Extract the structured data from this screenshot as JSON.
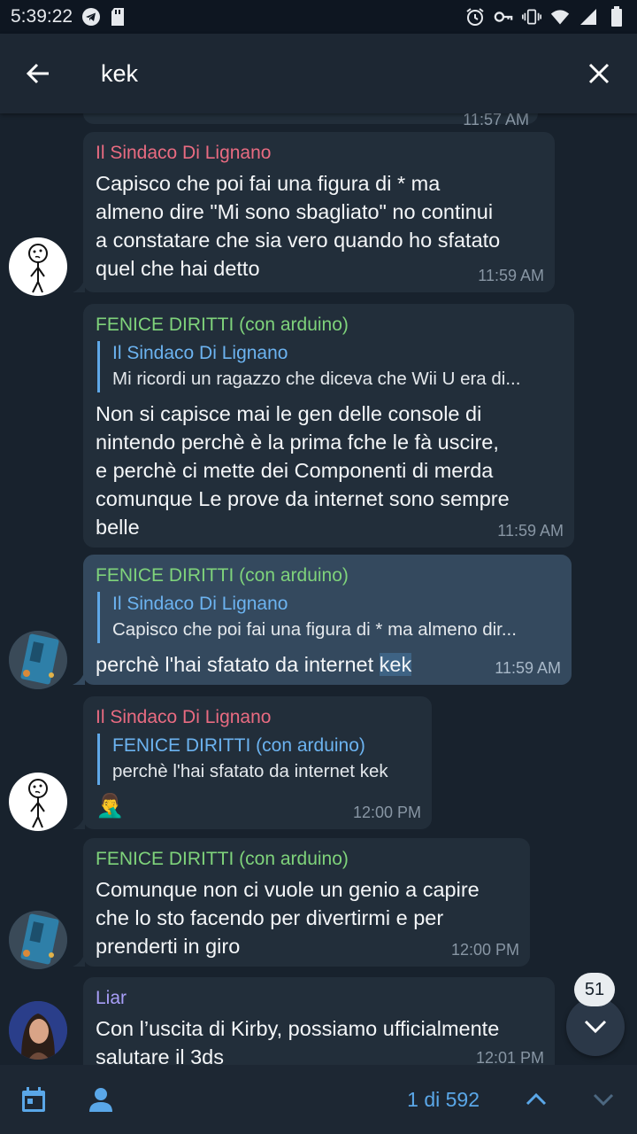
{
  "status": {
    "time": "5:39:22",
    "left_icons": [
      "telegram-icon",
      "sd-card-icon"
    ],
    "right_icons": [
      "alarm-icon",
      "vpn-key-icon",
      "vibrate-icon",
      "wifi-icon",
      "signal-icon",
      "battery-icon"
    ]
  },
  "search": {
    "query": "kek"
  },
  "partial_top_time": "11:57 AM",
  "messages": [
    {
      "sender": "Il Sindaco Di Lignano",
      "text": "Capisco che poi fai una figura di * ma\nalmeno dire \"Mi sono sbagliato\" no continui\na constatare che sia vero quando ho sfatato\nquel che hai detto",
      "time": "11:59 AM"
    },
    {
      "sender": "FENICE DIRITTI (con arduino)",
      "reply_name": "Il Sindaco Di Lignano",
      "reply_text": "Mi ricordi un ragazzo che diceva che Wii U era di...",
      "text": "Non si capisce mai le gen delle console di\nnintendo perchè è la prima fche le fà uscire,\ne perchè ci mette dei Componenti di merda\ncomunque Le prove da internet sono sempre\nbelle",
      "time": "11:59 AM"
    },
    {
      "sender": "FENICE DIRITTI (con arduino)",
      "reply_name": "Il Sindaco Di Lignano",
      "reply_text": "Capisco che poi fai una figura di * ma almeno dir...",
      "text_before": "perchè l'hai sfatato da internet ",
      "highlight": "kek",
      "time": "11:59 AM"
    },
    {
      "sender": "Il Sindaco Di Lignano",
      "reply_name": "FENICE DIRITTI (con arduino)",
      "reply_text": "perchè l'hai sfatato da internet kek",
      "emoji": "🤦‍♂️",
      "time": "12:00 PM"
    },
    {
      "sender": "FENICE DIRITTI (con arduino)",
      "text": "Comunque non ci vuole un genio a capire\nche lo sto facendo per divertirmi e per\nprenderti in giro",
      "time": "12:00 PM"
    },
    {
      "sender": "Liar",
      "text": "Con l’uscita di Kirby, possiamo ufficialmente\nsalutare il 3ds",
      "time": "12:01 PM"
    }
  ],
  "unread_badge": "51",
  "bottom": {
    "result_counter": "1 di 592"
  },
  "colors": {
    "background": "#18222d",
    "bubble": "#222e3a",
    "bubble_highlight": "#34495e",
    "accent": "#5aa7e8",
    "sender_red": "#e96b81",
    "sender_green": "#7fd37b",
    "sender_purple": "#a89ef7"
  }
}
